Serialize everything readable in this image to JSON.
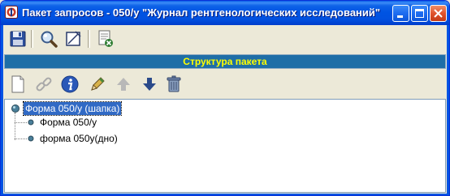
{
  "window": {
    "title": "Пакет запросов - 050/у \"Журнал рентгенологических исследований\""
  },
  "toolbar1": {
    "items": [
      {
        "name": "save",
        "icon": "floppy-disk-icon"
      },
      {
        "name": "search",
        "icon": "magnifier-icon"
      },
      {
        "name": "edit",
        "icon": "pencil-box-icon"
      },
      {
        "name": "document-delete",
        "icon": "document-delete-icon"
      }
    ]
  },
  "section": {
    "title": "Структура пакета"
  },
  "toolbar2": {
    "items": [
      {
        "name": "new",
        "icon": "new-document-icon"
      },
      {
        "name": "link",
        "icon": "chain-link-icon"
      },
      {
        "name": "info",
        "icon": "info-icon"
      },
      {
        "name": "edit",
        "icon": "pencil-icon"
      },
      {
        "name": "move-up",
        "icon": "arrow-up-icon"
      },
      {
        "name": "move-down",
        "icon": "arrow-down-icon"
      },
      {
        "name": "delete",
        "icon": "trash-icon"
      }
    ]
  },
  "tree": {
    "root": {
      "label": "Форма 050/у (шапка)",
      "selected": true
    },
    "children": [
      {
        "label": "Форма 050/у"
      },
      {
        "label": "форма 050у(дно)"
      }
    ]
  },
  "colors": {
    "titlebar": "#0054e3",
    "section_bg": "#1e6ea7",
    "section_text": "#ffff00",
    "selection": "#316ac5"
  }
}
